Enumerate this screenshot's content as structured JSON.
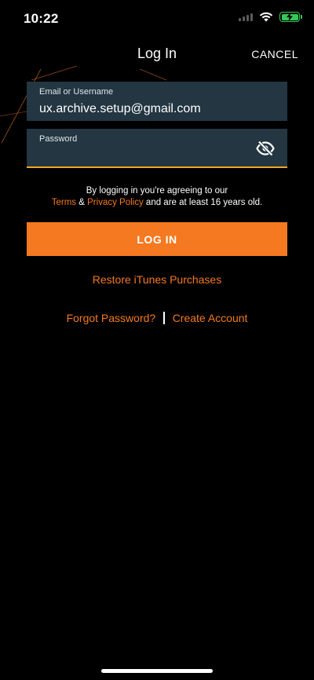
{
  "status": {
    "time": "10:22"
  },
  "nav": {
    "title": "Log In",
    "cancel": "CANCEL"
  },
  "form": {
    "email_label": "Email or Username",
    "email_value": "ux.archive.setup@gmail.com",
    "password_label": "Password",
    "password_value": ""
  },
  "legal": {
    "line1": "By logging in you're agreeing to our",
    "terms": "Terms",
    "amp": "&",
    "privacy": "Privacy Policy",
    "suffix": "and are at least 16 years old."
  },
  "actions": {
    "login": "LOG IN",
    "restore": "Restore iTunes Purchases",
    "forgot": "Forgot Password?",
    "create": "Create Account"
  },
  "colors": {
    "accent": "#f47920",
    "field_bg": "#233642",
    "underline": "#f5a623",
    "battery": "#34c759"
  },
  "icons": [
    "signal-icon",
    "wifi-icon",
    "battery-charging-icon",
    "eye-slash-icon"
  ]
}
